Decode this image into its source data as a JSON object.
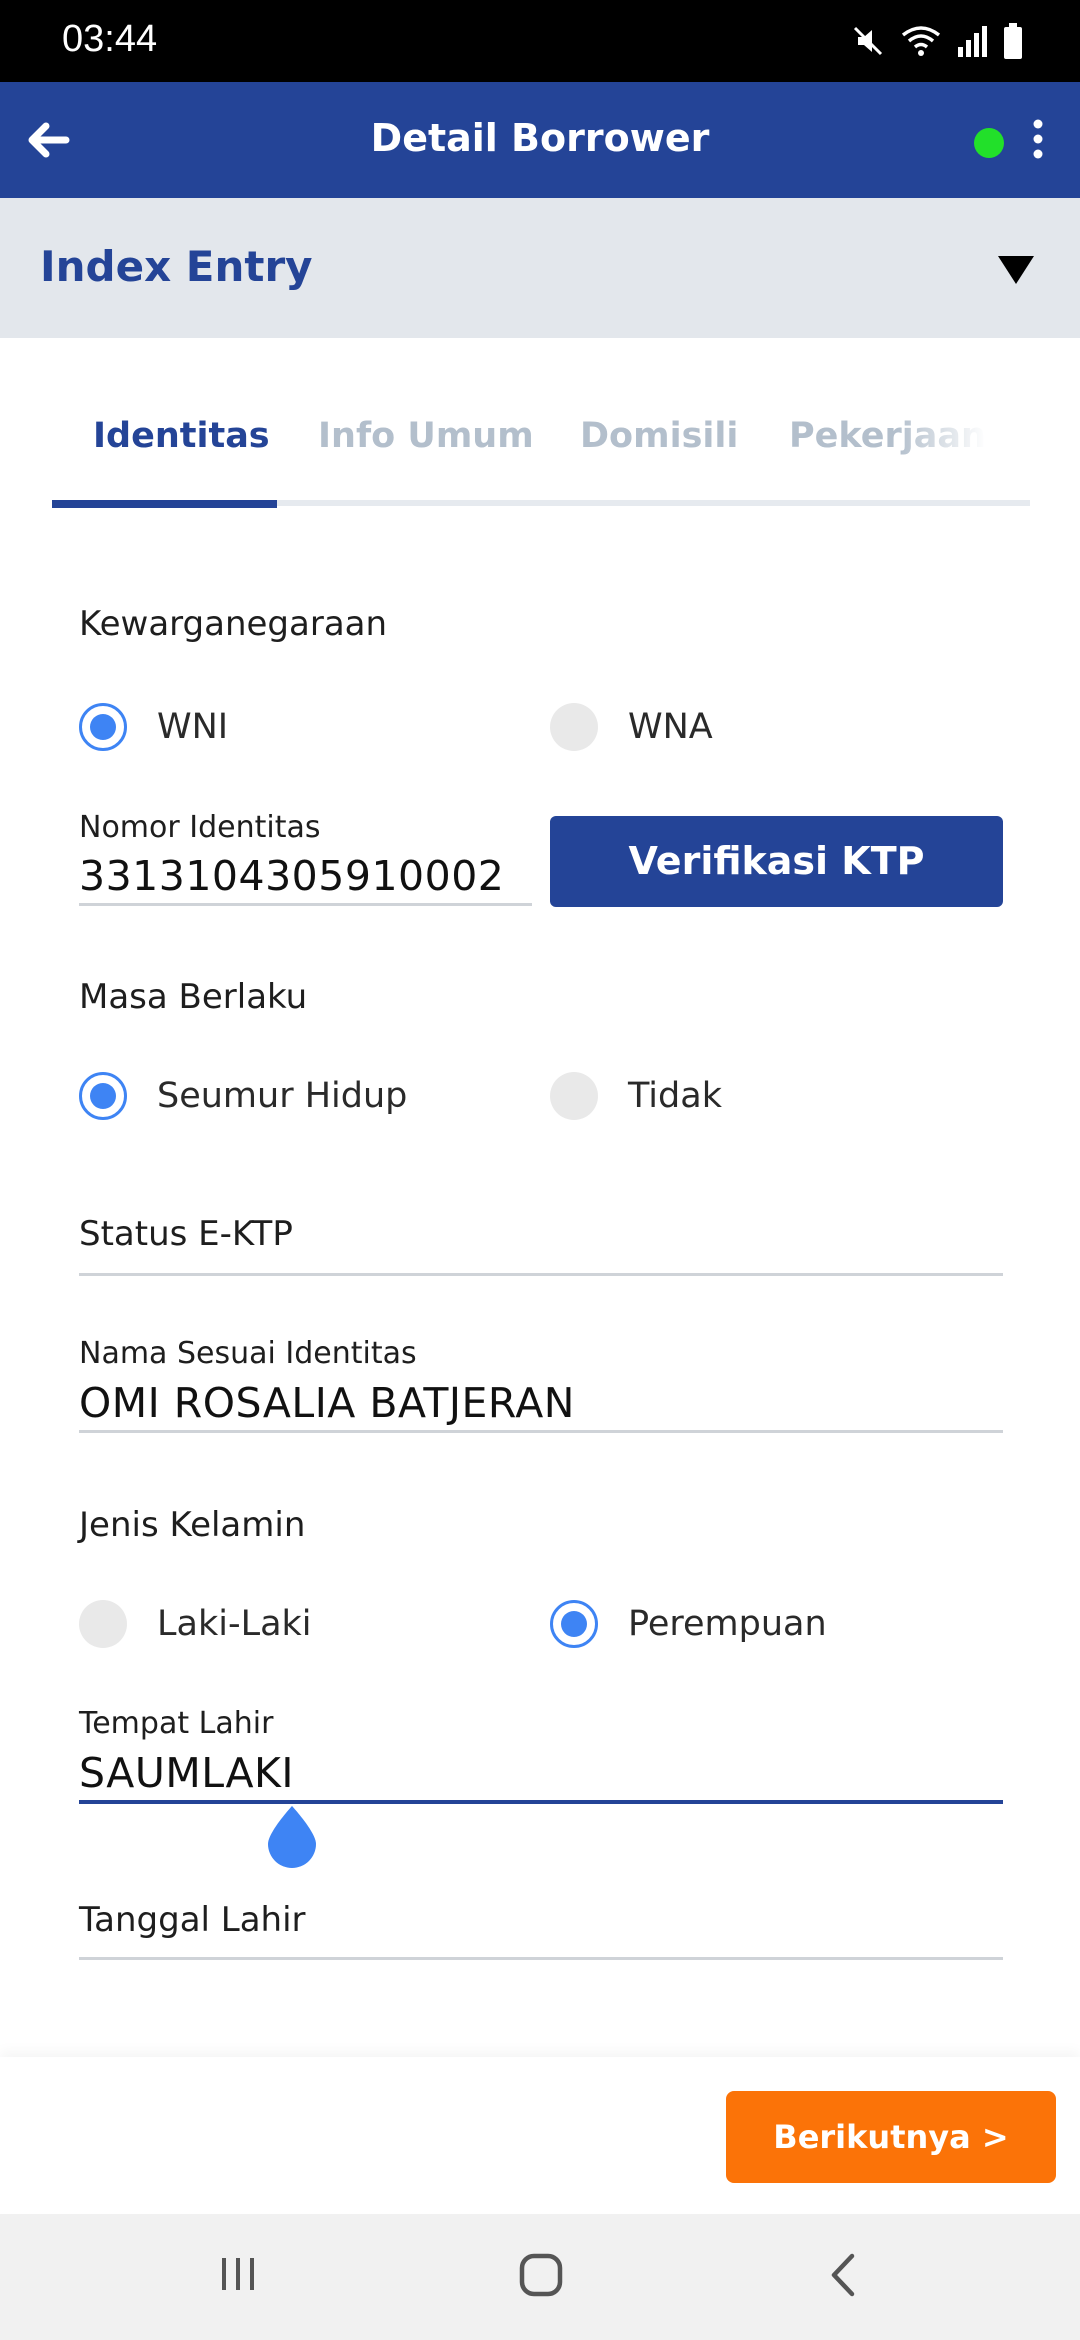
{
  "status_bar": {
    "time": "03:44",
    "icons": [
      "mute-icon",
      "wifi-icon",
      "signal-icon",
      "battery-icon"
    ]
  },
  "app_bar": {
    "title": "Detail Borrower",
    "status_dot_color": "#22e02a"
  },
  "section": {
    "title": "Index Entry"
  },
  "tabs": [
    {
      "label": "Identitas",
      "active": true
    },
    {
      "label": "Info Umum",
      "active": false
    },
    {
      "label": "Domisili",
      "active": false
    },
    {
      "label": "Pekerjaan",
      "active": false
    }
  ],
  "form": {
    "kewarganegaraan": {
      "label": "Kewarganegaraan",
      "options": [
        "WNI",
        "WNA"
      ],
      "selected": "WNI"
    },
    "nomor_identitas": {
      "label": "Nomor Identitas",
      "value": "3313104305910002"
    },
    "verify_button": "Verifikasi KTP",
    "masa_berlaku": {
      "label": "Masa Berlaku",
      "options": [
        "Seumur Hidup",
        "Tidak"
      ],
      "selected": "Seumur Hidup"
    },
    "status_ektp": {
      "label": "Status E-KTP"
    },
    "nama": {
      "label": "Nama Sesuai Identitas",
      "value": "OMI ROSALIA BATJERAN"
    },
    "jenis_kelamin": {
      "label": "Jenis Kelamin",
      "options": [
        "Laki-Laki",
        "Perempuan"
      ],
      "selected": "Perempuan"
    },
    "tempat_lahir": {
      "label": "Tempat Lahir",
      "value": "SAUMLAKI"
    },
    "tanggal_lahir": {
      "label": "Tanggal Lahir"
    }
  },
  "next_button": "Berikutnya >",
  "colors": {
    "primary": "#244497",
    "accent": "#fb7308",
    "radio": "#3e84f4"
  }
}
